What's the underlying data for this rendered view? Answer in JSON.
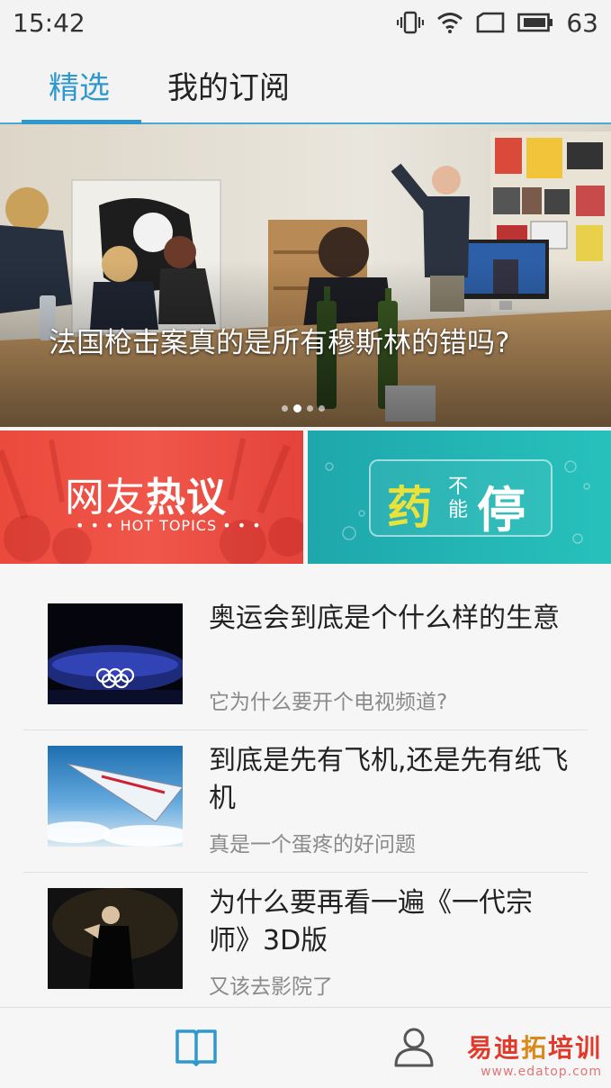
{
  "status_bar": {
    "time": "15:42",
    "battery": "63",
    "icons": [
      "vibrate-icon",
      "wifi-icon",
      "sim-icon",
      "battery-icon"
    ]
  },
  "tabs": [
    {
      "label": "精选",
      "active": true
    },
    {
      "label": "我的订阅",
      "active": false
    }
  ],
  "hero": {
    "title": "法国枪击案真的是所有穆斯林的错吗?",
    "slide_count": 4,
    "active_slide": 2
  },
  "banners": {
    "hot": {
      "title_part1": "网友",
      "title_part2": "热议",
      "subtitle": "• • • HOT TOPICS • • •"
    },
    "medicine": {
      "char1": "药",
      "small": "不能",
      "char2": "停"
    }
  },
  "articles": [
    {
      "title": "奥运会到底是个什么样的生意",
      "subtitle": "它为什么要开个电视频道?"
    },
    {
      "title": "到底是先有飞机,还是先有纸飞机",
      "subtitle": "真是一个蛋疼的好问题"
    },
    {
      "title": "为什么要再看一遍《一代宗师》3D版",
      "subtitle": "又该去影院了"
    }
  ],
  "bottom_nav": [
    {
      "icon": "book-icon",
      "active": true
    },
    {
      "icon": "user-icon",
      "active": false
    }
  ],
  "watermark": {
    "text_a": "易迪",
    "text_b": "拓",
    "text_c": "培训",
    "url": "www.edatop.com"
  },
  "colors": {
    "accent": "#2e98cf",
    "hot_red": "#ea4a3c",
    "teal": "#1fa7ac"
  }
}
